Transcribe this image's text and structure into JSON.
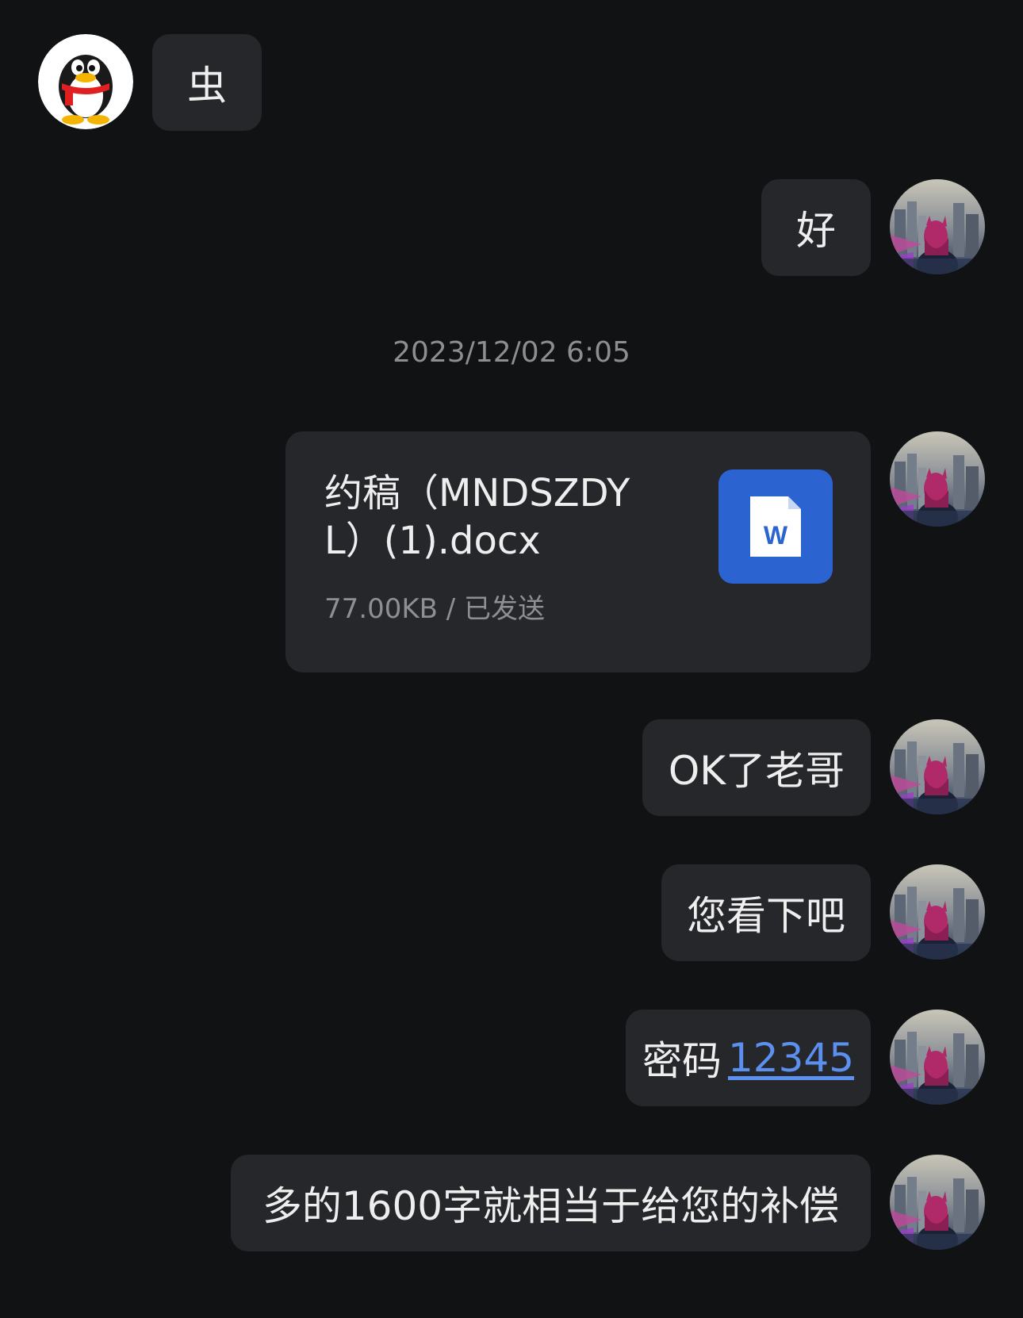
{
  "messages": [
    {
      "side": "left",
      "text": "虫"
    },
    {
      "side": "right",
      "text": "好"
    }
  ],
  "timestamp": "2023/12/02 6:05",
  "file": {
    "name": "约稿（MNDSZDYL）(1).docx",
    "meta": "77.00KB / 已发送",
    "icon": "word-doc-icon",
    "icon_color": "#2b63d0"
  },
  "later_messages": [
    {
      "text": "OK了老哥"
    },
    {
      "text": "您看下吧"
    },
    {
      "prefix": "密码",
      "link": "12345"
    },
    {
      "text": "多的1600字就相当于给您的补偿"
    }
  ],
  "colors": {
    "background": "#111214",
    "bubble": "#26272b",
    "link": "#5b8ff0"
  }
}
